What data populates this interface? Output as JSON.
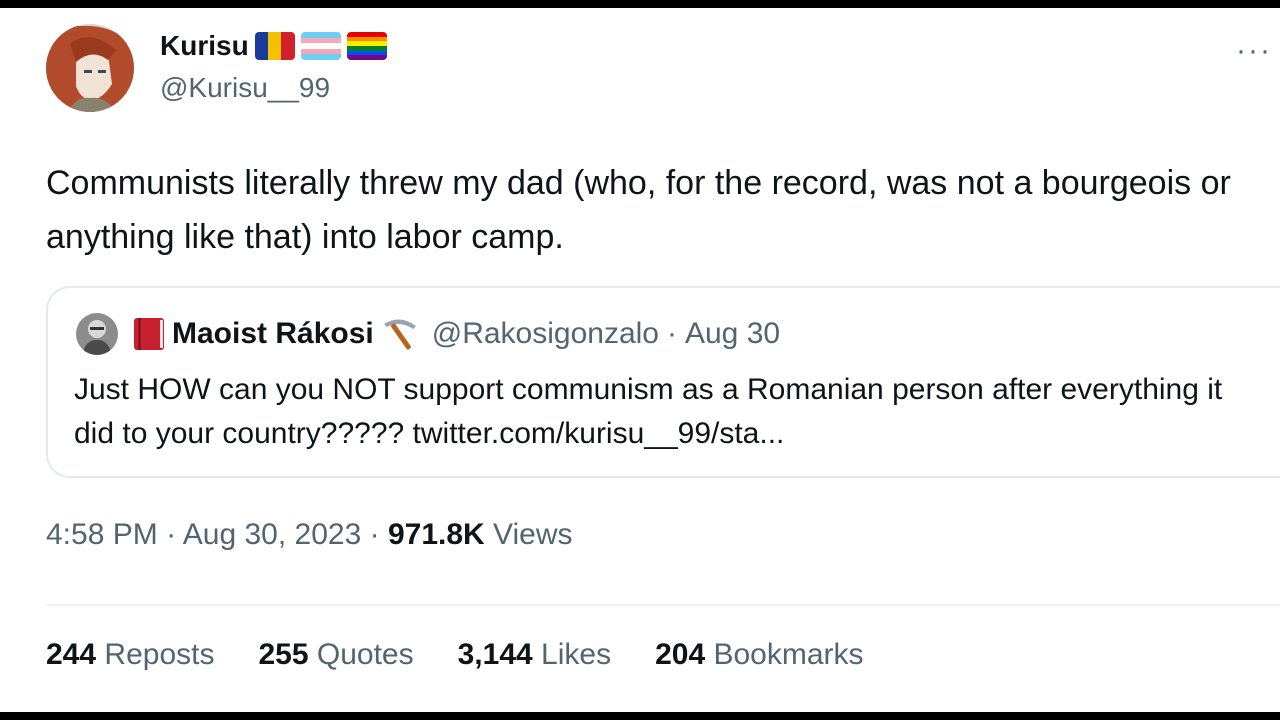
{
  "author": {
    "display_name": "Kurisu",
    "handle": "@Kurisu__99",
    "avatar_icon": "anime-avatar-icon",
    "badges": [
      "romania-flag-icon",
      "trans-flag-icon",
      "rainbow-flag-icon"
    ]
  },
  "tweet": {
    "text": "Communists literally threw my dad (who, for the record, was not a bourgeois or anything like that) into labor camp.",
    "more_icon": "more-options-icon"
  },
  "quoted": {
    "display_name": "Maoist Rákosi",
    "handle": "@Rakosigonzalo",
    "separator": "·",
    "date": "Aug 30",
    "text": "Just HOW can you NOT support communism as a Romanian person after everything it did to your country????? twitter.com/kurisu__99/sta...",
    "icons": [
      "book-icon",
      "pickaxe-icon"
    ]
  },
  "meta": {
    "time": "4:58 PM",
    "sep1": "·",
    "date": "Aug 30, 2023",
    "sep2": "·",
    "views_count": "971.8K",
    "views_label": "Views"
  },
  "stats": [
    {
      "count": "244",
      "label": "Reposts"
    },
    {
      "count": "255",
      "label": "Quotes"
    },
    {
      "count": "3,144",
      "label": "Likes"
    },
    {
      "count": "204",
      "label": "Bookmarks"
    }
  ],
  "colors": {
    "text": "#0f1419",
    "secondary": "#536471",
    "border": "#e7eaed"
  }
}
